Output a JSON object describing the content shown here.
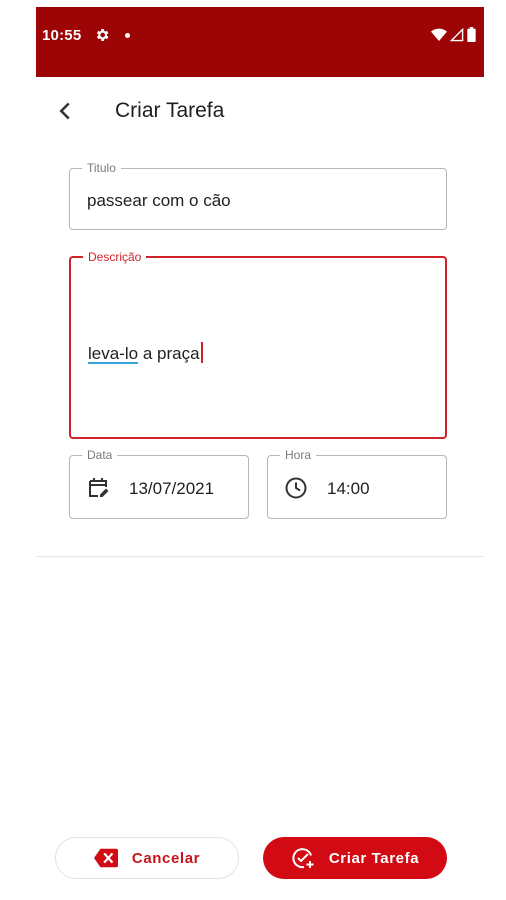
{
  "status_bar": {
    "time": "10:55",
    "icons": [
      "gear-icon",
      "dot-icon",
      "wifi-icon",
      "signal-icon",
      "battery-icon"
    ],
    "color": "#9d0405"
  },
  "app_bar": {
    "back_icon": "chevron-left-icon",
    "title": "Criar Tarefa"
  },
  "form": {
    "titulo": {
      "label": "Titulo",
      "value": "passear com o cão"
    },
    "descricao": {
      "label": "Descrição",
      "value_underlined": "leva-lo",
      "value_rest": " a praça",
      "focused": true
    },
    "data": {
      "label": "Data",
      "value": "13/07/2021",
      "icon": "calendar-edit-icon"
    },
    "hora": {
      "label": "Hora",
      "value": "14:00",
      "icon": "clock-icon"
    }
  },
  "actions": {
    "cancel": {
      "label": "Cancelar",
      "icon": "backspace-x-icon"
    },
    "create": {
      "label": "Criar Tarefa",
      "icon": "check-circle-add-icon"
    }
  },
  "colors": {
    "accent": "#d10a14",
    "focus": "#d1232a",
    "text": "#202020"
  }
}
